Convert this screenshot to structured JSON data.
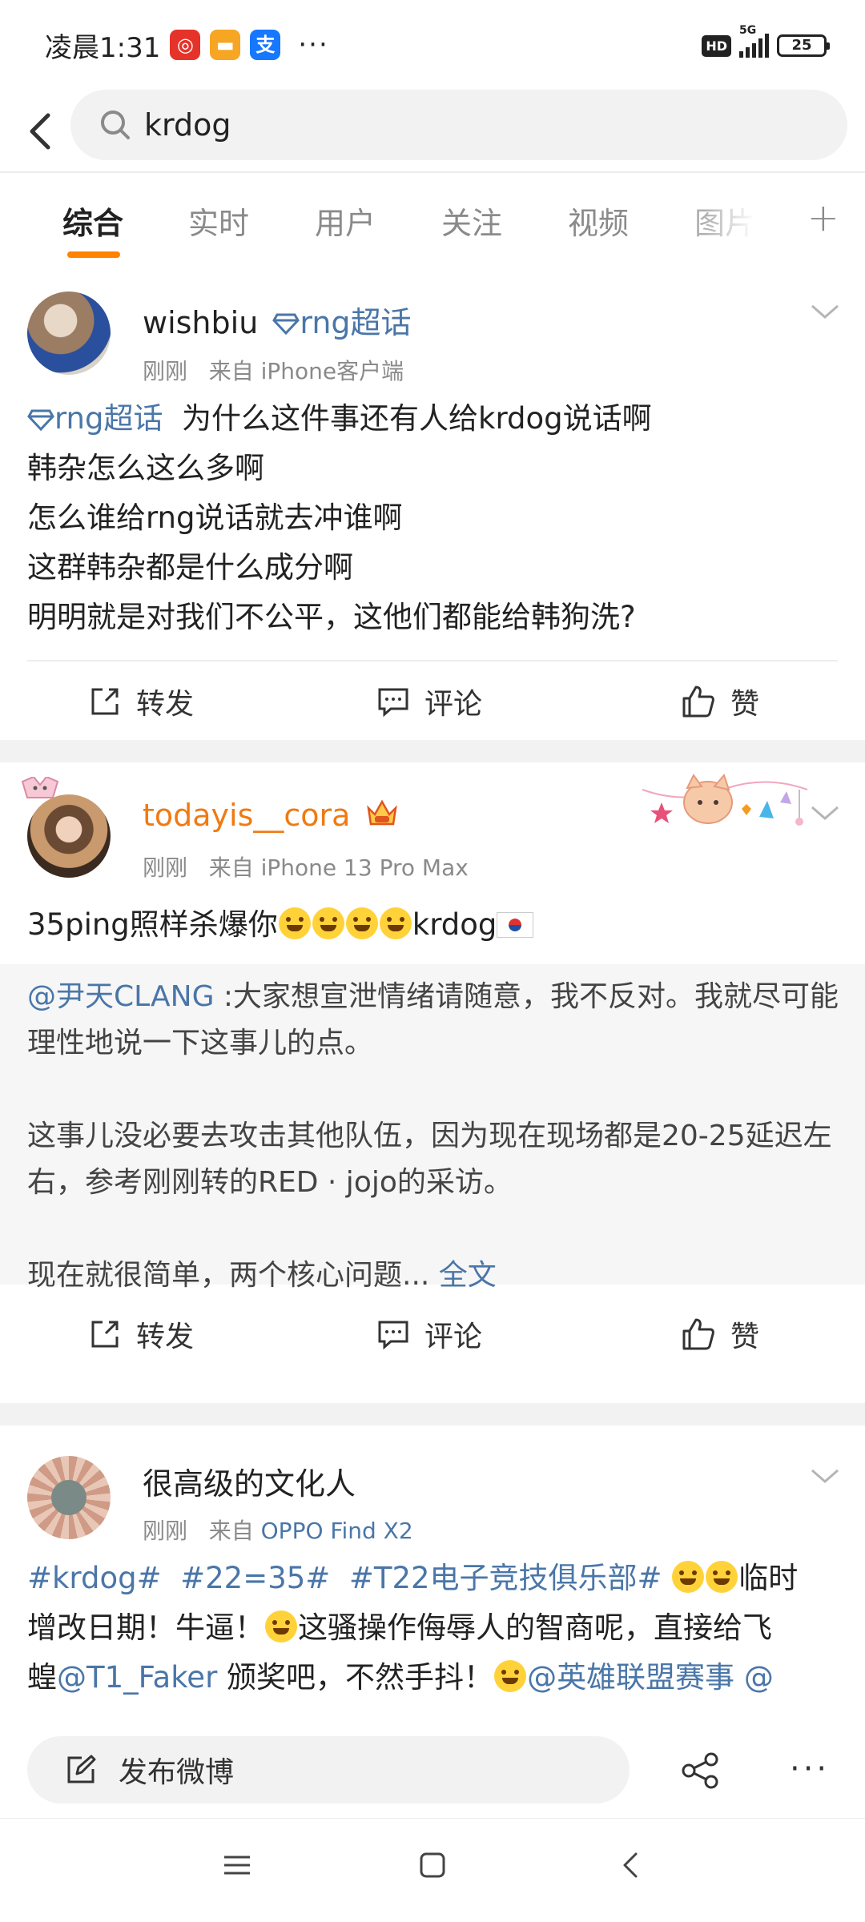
{
  "status_bar": {
    "time": "凌晨1:31",
    "apps": [
      {
        "name": "netease-music",
        "glyph": "◎",
        "color": "#e6332a"
      },
      {
        "name": "notes",
        "glyph": "▬",
        "color": "#f6a623"
      },
      {
        "name": "alipay",
        "glyph": "支",
        "color": "#1677ff"
      }
    ],
    "more": "···",
    "hd": "HD",
    "network": "5G",
    "battery": "25"
  },
  "search": {
    "query": "krdog"
  },
  "tabs": [
    {
      "label": "综合",
      "active": true
    },
    {
      "label": "实时"
    },
    {
      "label": "用户"
    },
    {
      "label": "关注"
    },
    {
      "label": "视频"
    },
    {
      "label": "图片"
    }
  ],
  "posts": [
    {
      "username": "wishbiu",
      "topic_tag": "rng超话",
      "time": "刚刚",
      "source_prefix": "来自",
      "source": "iPhone客户端",
      "topic_prefix": "rng超话",
      "lines": [
        "为什么这件事还有人给krdog说话啊",
        "韩杂怎么这么多啊",
        "怎么谁给rng说话就去冲谁啊",
        "这群韩杂都是什么成分啊",
        "明明就是对我们不公平，这他们都能给韩狗洗?"
      ],
      "actions": {
        "repost": "转发",
        "comment": "评论",
        "like": "赞"
      }
    },
    {
      "username": "todayis__cora",
      "time": "刚刚",
      "source_prefix": "来自",
      "source": "iPhone 13 Pro Max",
      "text_before": "35ping照样杀爆你",
      "text_after": "krdog",
      "quote": {
        "mention": "@尹天CLANG",
        "text1": " :大家想宣泄情绪请随意，我不反对。我就尽可能理性地说一下这事儿的点。",
        "text2": "这事儿没必要去攻击其他队伍，因为现在现场都是20-25延迟左右，参考刚刚转的RED · jojo的采访。",
        "text3": "现在就很简单，两个核心问题...",
        "full_text": "全文"
      },
      "actions": {
        "repost": "转发",
        "comment": "评论",
        "like": "赞"
      }
    },
    {
      "username": "很高级的文化人",
      "time": "刚刚",
      "source_prefix": "来自",
      "source": "OPPO Find X2",
      "tags": [
        "#krdog#",
        "#22=35#",
        "#T22电子竞技俱乐部#"
      ],
      "seg1": "临时",
      "seg2": "增改日期！牛逼！",
      "seg3": "这骚操作侮辱人的智商呢，直接给飞",
      "seg4": "蝗",
      "mention1": "@T1_Faker",
      "seg5": " 颁奖吧，不然手抖！",
      "mention2": "@英雄联盟赛事",
      "mention3": " @"
    }
  ],
  "compose": {
    "label": "发布微博"
  },
  "colors": {
    "accent": "#ff8200",
    "link": "#4a76a8",
    "vip_name": "#f07a12"
  }
}
